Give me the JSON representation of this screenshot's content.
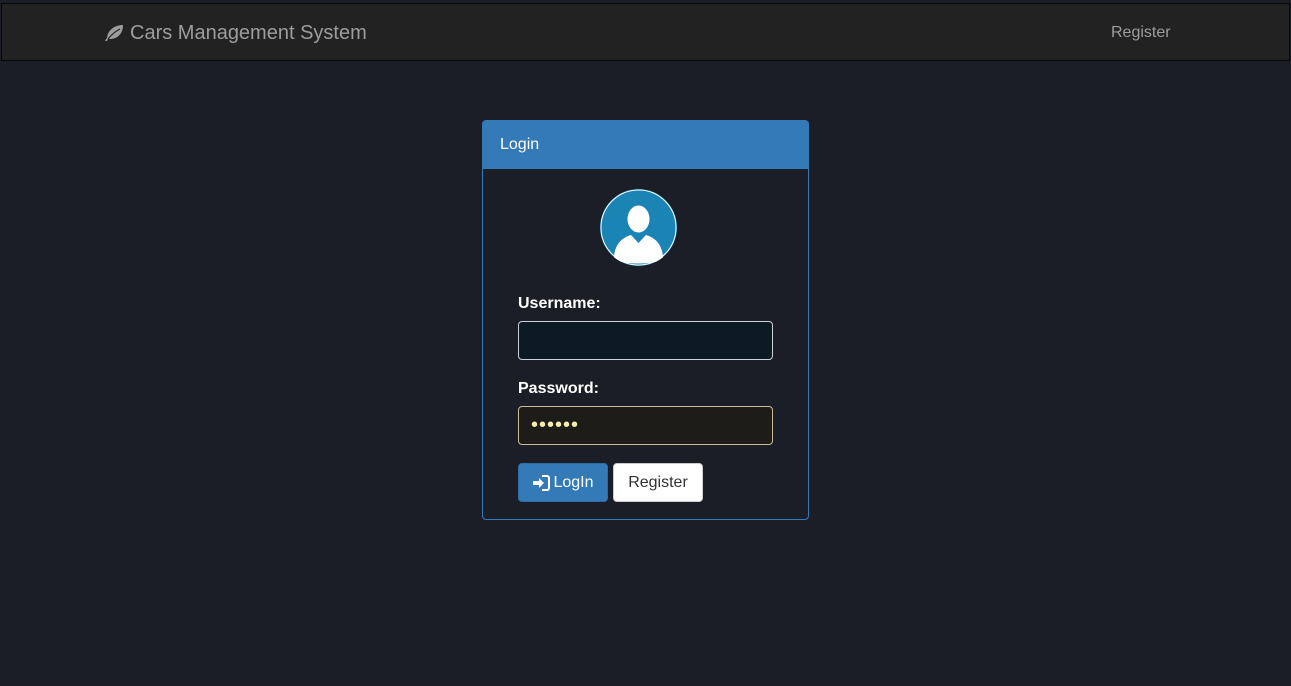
{
  "navbar": {
    "brand": "Cars Management System",
    "brand_icon": "leaf-icon",
    "register_link": "Register"
  },
  "login_panel": {
    "heading": "Login",
    "avatar_icon": "user-avatar-icon",
    "username_label": "Username:",
    "username_value": "",
    "password_label": "Password:",
    "password_value": "••••••",
    "login_button": "LogIn",
    "login_icon": "sign-in-icon",
    "register_button": "Register"
  },
  "colors": {
    "background": "#1b1e26",
    "navbar": "#222222",
    "primary": "#337ab7",
    "avatar": "#1a84b4"
  }
}
